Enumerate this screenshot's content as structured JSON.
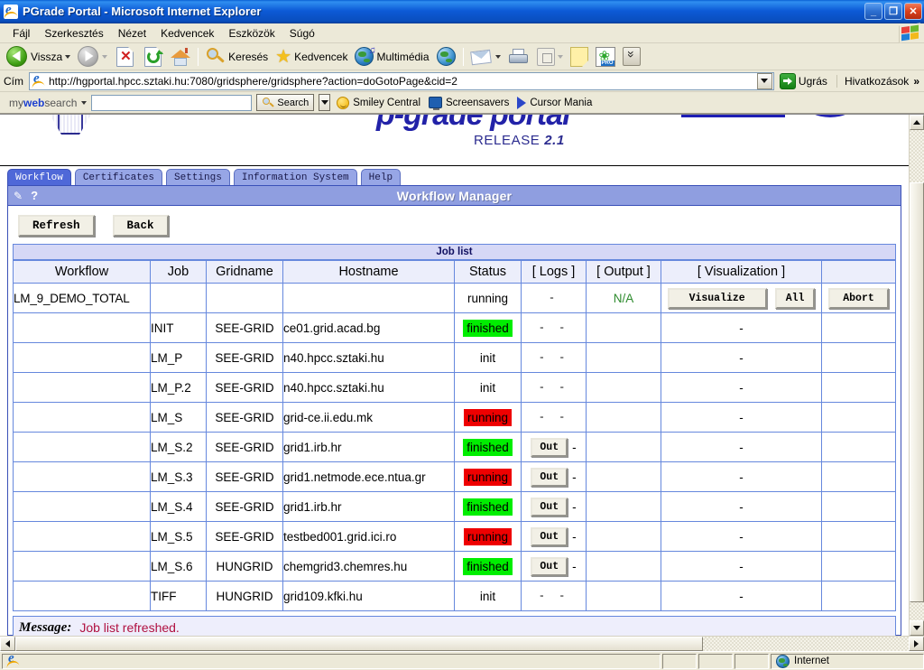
{
  "window": {
    "title": "PGrade Portal - Microsoft Internet Explorer",
    "icon": "ie-document-icon",
    "minimize": "_",
    "restore": "❐",
    "close": "✕"
  },
  "menu": {
    "items": [
      {
        "label": "Fájl"
      },
      {
        "label": "Szerkesztés"
      },
      {
        "label": "Nézet"
      },
      {
        "label": "Kedvencek"
      },
      {
        "label": "Eszközök"
      },
      {
        "label": "Súgó"
      }
    ]
  },
  "toolbar": {
    "back_label": "Vissza",
    "forward_label": "",
    "search_label": "Keresés",
    "favorites_label": "Kedvencek",
    "media_label": "Multimédia",
    "icons": [
      "back-arrow-icon",
      "forward-arrow-icon",
      "stop-icon",
      "refresh-icon",
      "home-icon",
      "search-icon",
      "favorites-star-icon",
      "media-icon",
      "history-icon",
      "mail-icon",
      "print-icon",
      "edit-icon",
      "notes-icon",
      "pro-icon",
      "download-icon"
    ]
  },
  "address": {
    "label": "Cím",
    "url": "http://hgportal.hpcc.sztaki.hu:7080/gridsphere/gridsphere?action=doGotoPage&cid=2",
    "go_label": "Ugrás",
    "links_label": "Hivatkozások",
    "links_overflow": "»"
  },
  "mywebsearch": {
    "brand_my": "my",
    "brand_web": "web",
    "brand_search": "search",
    "input_value": "",
    "input_placeholder": "",
    "search_button": "Search",
    "items": [
      {
        "label": "Smiley Central",
        "icon": "smiley-icon"
      },
      {
        "label": "Screensavers",
        "icon": "monitor-icon"
      },
      {
        "label": "Cursor Mania",
        "icon": "cursor-triangle-icon"
      }
    ]
  },
  "banner": {
    "product": "p-grade portal",
    "release_label": "RELEASE",
    "release_version": "2.1"
  },
  "tabs": [
    {
      "label": "Workflow",
      "active": true
    },
    {
      "label": "Certificates",
      "active": false
    },
    {
      "label": "Settings",
      "active": false
    },
    {
      "label": "Information System",
      "active": false
    },
    {
      "label": "Help",
      "active": false
    }
  ],
  "portlet": {
    "title": "Workflow Manager",
    "edit_icon": "pencil-icon",
    "help_icon": "question-mark-icon",
    "buttons": {
      "refresh": "Refresh",
      "back": "Back"
    }
  },
  "table": {
    "caption": "Job list",
    "headers": [
      "Workflow",
      "Job",
      "Gridname",
      "Hostname",
      "Status",
      "[ Logs ]",
      "[ Output ]",
      "[ Visualization ]",
      ""
    ],
    "rows": [
      {
        "workflow": "LM_9_DEMO_TOTAL",
        "job": "",
        "gridname": "",
        "hostname": "",
        "status": "running",
        "status_style": "plain",
        "logs": "-",
        "logs_button": null,
        "output": "N/A",
        "output_style": "na",
        "visualization_buttons": [
          "Visualize",
          "All"
        ],
        "visualization": null,
        "action_button": "Abort"
      },
      {
        "workflow": "",
        "job": "INIT",
        "gridname": "SEE-GRID",
        "hostname": "ce01.grid.acad.bg",
        "status": "finished",
        "status_style": "finished",
        "logs": "- -",
        "logs_button": null,
        "output": "",
        "output_style": "plain",
        "visualization_buttons": null,
        "visualization": "-",
        "action_button": null
      },
      {
        "workflow": "",
        "job": "LM_P",
        "gridname": "SEE-GRID",
        "hostname": "n40.hpcc.sztaki.hu",
        "status": "init",
        "status_style": "plain",
        "logs": "- -",
        "logs_button": null,
        "output": "",
        "output_style": "plain",
        "visualization_buttons": null,
        "visualization": "-",
        "action_button": null
      },
      {
        "workflow": "",
        "job": "LM_P.2",
        "gridname": "SEE-GRID",
        "hostname": "n40.hpcc.sztaki.hu",
        "status": "init",
        "status_style": "plain",
        "logs": "- -",
        "logs_button": null,
        "output": "",
        "output_style": "plain",
        "visualization_buttons": null,
        "visualization": "-",
        "action_button": null
      },
      {
        "workflow": "",
        "job": "LM_S",
        "gridname": "SEE-GRID",
        "hostname": "grid-ce.ii.edu.mk",
        "status": "running",
        "status_style": "running",
        "logs": "- -",
        "logs_button": null,
        "output": "",
        "output_style": "plain",
        "visualization_buttons": null,
        "visualization": "-",
        "action_button": null
      },
      {
        "workflow": "",
        "job": "LM_S.2",
        "gridname": "SEE-GRID",
        "hostname": "grid1.irb.hr",
        "status": "finished",
        "status_style": "finished",
        "logs": "-",
        "logs_button": "Out",
        "output": "",
        "output_style": "plain",
        "visualization_buttons": null,
        "visualization": "-",
        "action_button": null
      },
      {
        "workflow": "",
        "job": "LM_S.3",
        "gridname": "SEE-GRID",
        "hostname": "grid1.netmode.ece.ntua.gr",
        "status": "running",
        "status_style": "running",
        "logs": "-",
        "logs_button": "Out",
        "output": "",
        "output_style": "plain",
        "visualization_buttons": null,
        "visualization": "-",
        "action_button": null
      },
      {
        "workflow": "",
        "job": "LM_S.4",
        "gridname": "SEE-GRID",
        "hostname": "grid1.irb.hr",
        "status": "finished",
        "status_style": "finished",
        "logs": "-",
        "logs_button": "Out",
        "output": "",
        "output_style": "plain",
        "visualization_buttons": null,
        "visualization": "-",
        "action_button": null
      },
      {
        "workflow": "",
        "job": "LM_S.5",
        "gridname": "SEE-GRID",
        "hostname": "testbed001.grid.ici.ro",
        "status": "running",
        "status_style": "running",
        "logs": "-",
        "logs_button": "Out",
        "output": "",
        "output_style": "plain",
        "visualization_buttons": null,
        "visualization": "-",
        "action_button": null
      },
      {
        "workflow": "",
        "job": "LM_S.6",
        "gridname": "HUNGRID",
        "hostname": "chemgrid3.chemres.hu",
        "status": "finished",
        "status_style": "finished",
        "logs": "-",
        "logs_button": "Out",
        "output": "",
        "output_style": "plain",
        "visualization_buttons": null,
        "visualization": "-",
        "action_button": null
      },
      {
        "workflow": "",
        "job": "TIFF",
        "gridname": "HUNGRID",
        "hostname": "grid109.kfki.hu",
        "status": "init",
        "status_style": "plain",
        "logs": "- -",
        "logs_button": null,
        "output": "",
        "output_style": "plain",
        "visualization_buttons": null,
        "visualization": "-",
        "action_button": null
      }
    ]
  },
  "message": {
    "label": "Message:",
    "text": "Job list refreshed."
  },
  "statusbar": {
    "zone": "Internet",
    "zone_icon": "globe-icon",
    "page_icon": "ie-icon"
  },
  "colors": {
    "title_bar": "#0c5ad6",
    "portlet_header": "#8f9ee0",
    "tab_active": "#4f68d8",
    "status_finished": "#00ee00",
    "status_running": "#ee0000",
    "message_text": "#b01040",
    "na_text": "#2e8b2e",
    "brand_blue": "#2222a8"
  }
}
